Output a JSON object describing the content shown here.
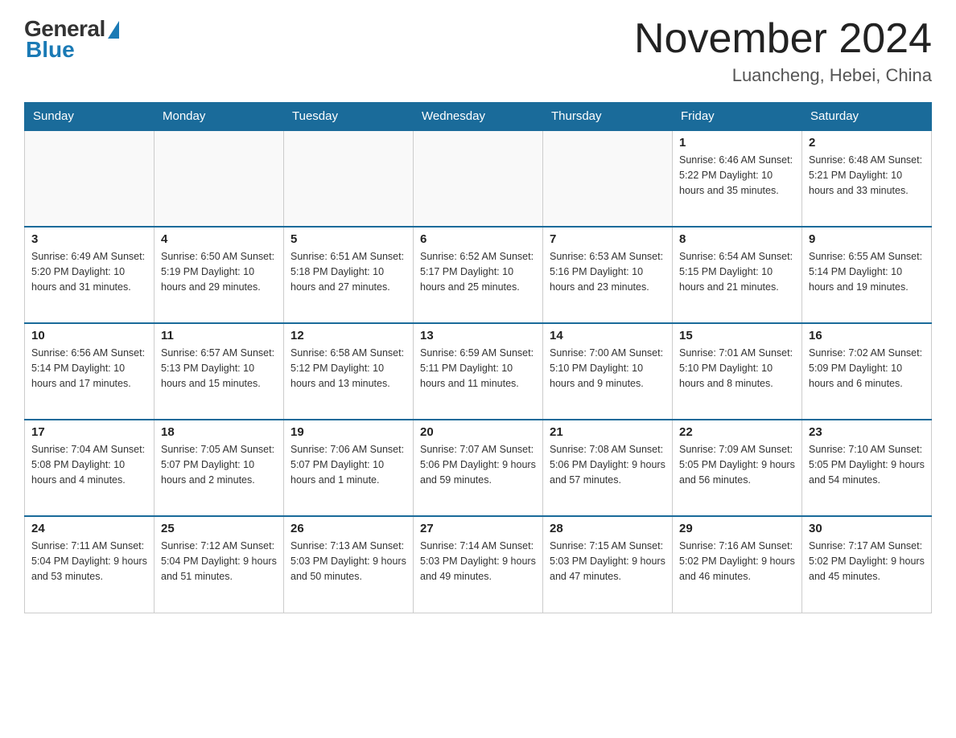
{
  "header": {
    "logo_general": "General",
    "logo_blue": "Blue",
    "month_title": "November 2024",
    "location": "Luancheng, Hebei, China"
  },
  "weekdays": [
    "Sunday",
    "Monday",
    "Tuesday",
    "Wednesday",
    "Thursday",
    "Friday",
    "Saturday"
  ],
  "weeks": [
    [
      {
        "day": "",
        "info": ""
      },
      {
        "day": "",
        "info": ""
      },
      {
        "day": "",
        "info": ""
      },
      {
        "day": "",
        "info": ""
      },
      {
        "day": "",
        "info": ""
      },
      {
        "day": "1",
        "info": "Sunrise: 6:46 AM\nSunset: 5:22 PM\nDaylight: 10 hours and 35 minutes."
      },
      {
        "day": "2",
        "info": "Sunrise: 6:48 AM\nSunset: 5:21 PM\nDaylight: 10 hours and 33 minutes."
      }
    ],
    [
      {
        "day": "3",
        "info": "Sunrise: 6:49 AM\nSunset: 5:20 PM\nDaylight: 10 hours and 31 minutes."
      },
      {
        "day": "4",
        "info": "Sunrise: 6:50 AM\nSunset: 5:19 PM\nDaylight: 10 hours and 29 minutes."
      },
      {
        "day": "5",
        "info": "Sunrise: 6:51 AM\nSunset: 5:18 PM\nDaylight: 10 hours and 27 minutes."
      },
      {
        "day": "6",
        "info": "Sunrise: 6:52 AM\nSunset: 5:17 PM\nDaylight: 10 hours and 25 minutes."
      },
      {
        "day": "7",
        "info": "Sunrise: 6:53 AM\nSunset: 5:16 PM\nDaylight: 10 hours and 23 minutes."
      },
      {
        "day": "8",
        "info": "Sunrise: 6:54 AM\nSunset: 5:15 PM\nDaylight: 10 hours and 21 minutes."
      },
      {
        "day": "9",
        "info": "Sunrise: 6:55 AM\nSunset: 5:14 PM\nDaylight: 10 hours and 19 minutes."
      }
    ],
    [
      {
        "day": "10",
        "info": "Sunrise: 6:56 AM\nSunset: 5:14 PM\nDaylight: 10 hours and 17 minutes."
      },
      {
        "day": "11",
        "info": "Sunrise: 6:57 AM\nSunset: 5:13 PM\nDaylight: 10 hours and 15 minutes."
      },
      {
        "day": "12",
        "info": "Sunrise: 6:58 AM\nSunset: 5:12 PM\nDaylight: 10 hours and 13 minutes."
      },
      {
        "day": "13",
        "info": "Sunrise: 6:59 AM\nSunset: 5:11 PM\nDaylight: 10 hours and 11 minutes."
      },
      {
        "day": "14",
        "info": "Sunrise: 7:00 AM\nSunset: 5:10 PM\nDaylight: 10 hours and 9 minutes."
      },
      {
        "day": "15",
        "info": "Sunrise: 7:01 AM\nSunset: 5:10 PM\nDaylight: 10 hours and 8 minutes."
      },
      {
        "day": "16",
        "info": "Sunrise: 7:02 AM\nSunset: 5:09 PM\nDaylight: 10 hours and 6 minutes."
      }
    ],
    [
      {
        "day": "17",
        "info": "Sunrise: 7:04 AM\nSunset: 5:08 PM\nDaylight: 10 hours and 4 minutes."
      },
      {
        "day": "18",
        "info": "Sunrise: 7:05 AM\nSunset: 5:07 PM\nDaylight: 10 hours and 2 minutes."
      },
      {
        "day": "19",
        "info": "Sunrise: 7:06 AM\nSunset: 5:07 PM\nDaylight: 10 hours and 1 minute."
      },
      {
        "day": "20",
        "info": "Sunrise: 7:07 AM\nSunset: 5:06 PM\nDaylight: 9 hours and 59 minutes."
      },
      {
        "day": "21",
        "info": "Sunrise: 7:08 AM\nSunset: 5:06 PM\nDaylight: 9 hours and 57 minutes."
      },
      {
        "day": "22",
        "info": "Sunrise: 7:09 AM\nSunset: 5:05 PM\nDaylight: 9 hours and 56 minutes."
      },
      {
        "day": "23",
        "info": "Sunrise: 7:10 AM\nSunset: 5:05 PM\nDaylight: 9 hours and 54 minutes."
      }
    ],
    [
      {
        "day": "24",
        "info": "Sunrise: 7:11 AM\nSunset: 5:04 PM\nDaylight: 9 hours and 53 minutes."
      },
      {
        "day": "25",
        "info": "Sunrise: 7:12 AM\nSunset: 5:04 PM\nDaylight: 9 hours and 51 minutes."
      },
      {
        "day": "26",
        "info": "Sunrise: 7:13 AM\nSunset: 5:03 PM\nDaylight: 9 hours and 50 minutes."
      },
      {
        "day": "27",
        "info": "Sunrise: 7:14 AM\nSunset: 5:03 PM\nDaylight: 9 hours and 49 minutes."
      },
      {
        "day": "28",
        "info": "Sunrise: 7:15 AM\nSunset: 5:03 PM\nDaylight: 9 hours and 47 minutes."
      },
      {
        "day": "29",
        "info": "Sunrise: 7:16 AM\nSunset: 5:02 PM\nDaylight: 9 hours and 46 minutes."
      },
      {
        "day": "30",
        "info": "Sunrise: 7:17 AM\nSunset: 5:02 PM\nDaylight: 9 hours and 45 minutes."
      }
    ]
  ]
}
